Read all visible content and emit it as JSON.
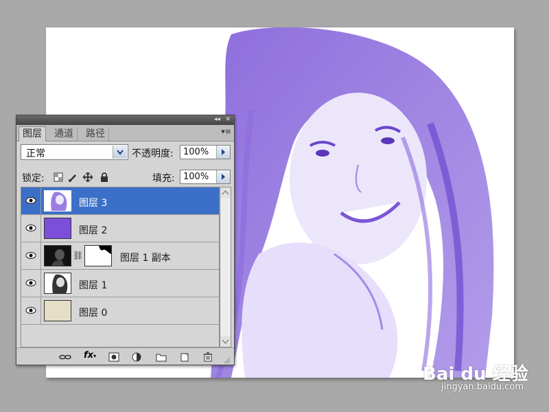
{
  "panel": {
    "tabs": [
      "图层",
      "通道",
      "路径"
    ],
    "blend_mode": "正常",
    "opacity_label": "不透明度:",
    "opacity_value": "100%",
    "lock_label": "锁定:",
    "fill_label": "填充:",
    "fill_value": "100%"
  },
  "layers": [
    {
      "name": "图层 3",
      "selected": true,
      "thumb": "purple-portrait"
    },
    {
      "name": "图层 2",
      "selected": false,
      "thumb": "solid-purple"
    },
    {
      "name": "图层 1 副本",
      "selected": false,
      "thumb": "dark-portrait",
      "has_mask": true
    },
    {
      "name": "图层 1",
      "selected": false,
      "thumb": "portrait"
    },
    {
      "name": "图层 0",
      "selected": false,
      "thumb": "paper-texture"
    }
  ],
  "colors": {
    "accent_purple": "#7b4fd9",
    "selection_blue": "#3c6fc8",
    "canvas_tint": "#8f6fe0"
  },
  "watermark": {
    "brand": "Bai du 经验",
    "url": "jingyan.baidu.com"
  }
}
